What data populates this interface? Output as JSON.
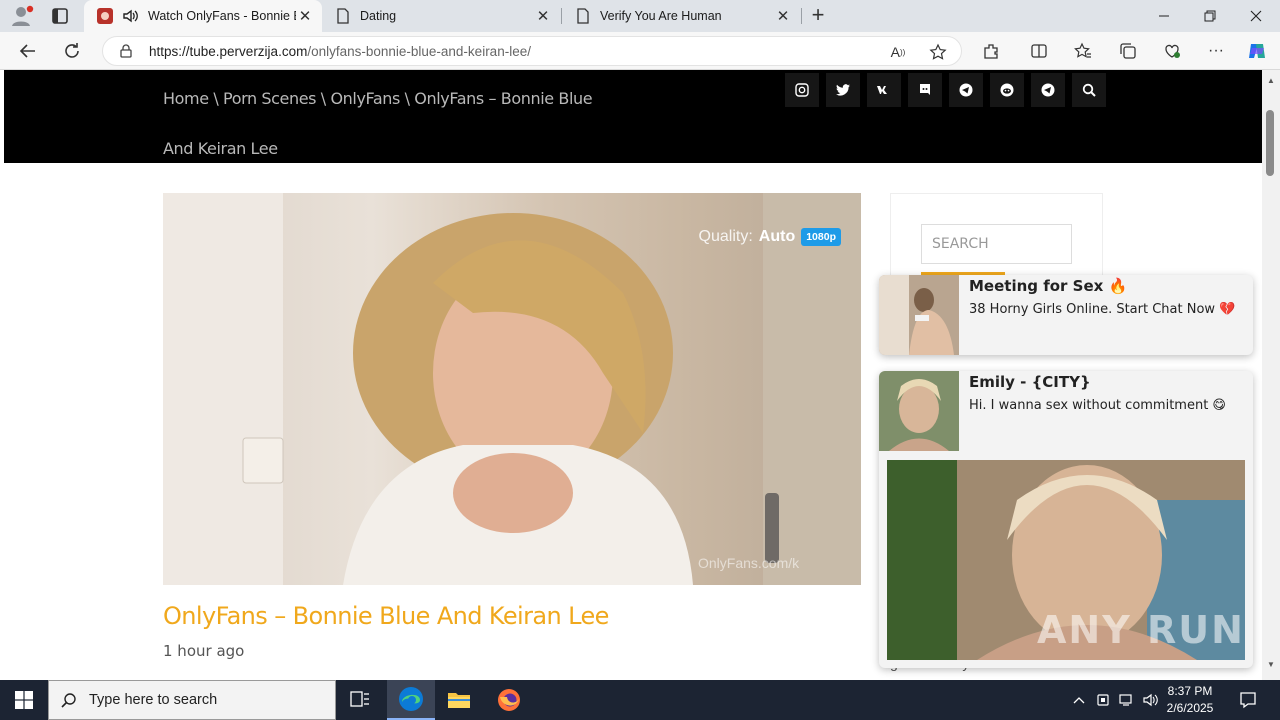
{
  "browser": {
    "tabs": [
      {
        "title": "Watch OnlyFans - Bonnie Bl",
        "active": true,
        "has_audio": true
      },
      {
        "title": "Dating",
        "active": false
      },
      {
        "title": "Verify You Are Human",
        "active": false
      }
    ],
    "url_host": "https://tube.perverzija.com",
    "url_path": "/onlyfans-bonnie-blue-and-keiran-lee/"
  },
  "site": {
    "breadcrumb": "Home \\ Porn Scenes \\ OnlyFans \\ OnlyFans – Bonnie Blue And Keiran Lee",
    "social_icons": [
      "instagram-icon",
      "twitter-icon",
      "vk-icon",
      "discord-icon",
      "telegram-icon",
      "reddit-icon",
      "telegram-icon",
      "search-icon"
    ],
    "video": {
      "quality_label": "Quality:",
      "quality_value": "Auto",
      "quality_badge": "1080p",
      "watermark": "OnlyFans.com/k"
    },
    "post_title": "OnlyFans – Bonnie Blue And Keiran Lee",
    "post_time": "1 hour ago",
    "sidebar_search_placeholder": "SEARCH",
    "behind_popup_text": "get back to you when we do."
  },
  "ads": [
    {
      "title": "Meeting for Sex 🔥",
      "text": "38 Horny Girls Online. Start Chat Now 💔"
    },
    {
      "title": "Emily - {CITY}",
      "text": "Hi. I wanna sex without commitment 😋"
    }
  ],
  "ad_watermark": "ANY RUN",
  "taskbar": {
    "search_placeholder": "Type here to search",
    "time": "8:37 PM",
    "date": "2/6/2025"
  },
  "colors": {
    "accent": "#f0a81c",
    "header_bg": "#000000",
    "badge_blue": "#1e9be8",
    "taskbar_bg": "#1c2433"
  }
}
